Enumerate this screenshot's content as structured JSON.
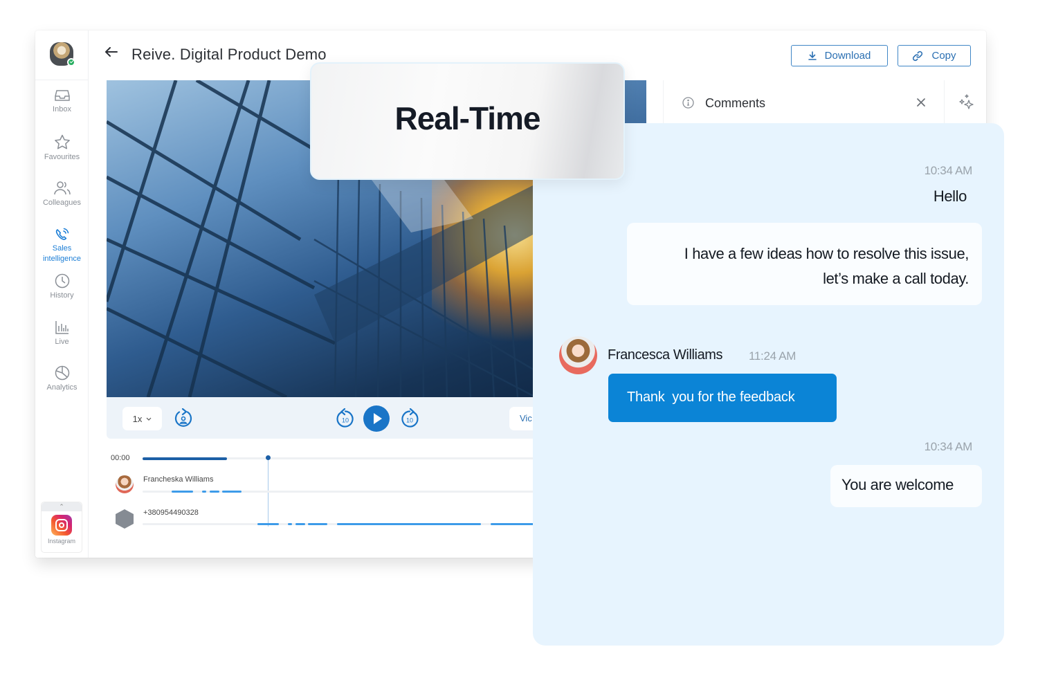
{
  "app": {
    "title": "Reive. Digital Product Demo",
    "actions": {
      "download_label": "Download",
      "copy_label": "Copy"
    }
  },
  "sidebar": {
    "items": [
      {
        "label": "Inbox",
        "icon": "inbox-icon",
        "active": false
      },
      {
        "label": "Favourites",
        "icon": "star-icon",
        "active": false
      },
      {
        "label": "Colleagues",
        "icon": "users-icon",
        "active": false
      },
      {
        "label_line1": "Sales",
        "label_line2": "intelligence",
        "icon": "phone-ringing-icon",
        "active": true
      },
      {
        "label": "History",
        "icon": "clock-icon",
        "active": false
      },
      {
        "label": "Live",
        "icon": "bar-chart-icon",
        "active": false
      },
      {
        "label": "Analytics",
        "icon": "pie-chart-icon",
        "active": false
      }
    ],
    "integration": {
      "label": "Instagram",
      "icon": "instagram-icon"
    }
  },
  "player": {
    "speed": "1x",
    "video_chip_label": "Vic",
    "skip_seconds": "10",
    "time": "00:00",
    "progress_fraction": 0.21
  },
  "timeline": {
    "speakers": [
      {
        "name": "Francheska Williams",
        "type": "person"
      },
      {
        "name": "+380954490328",
        "type": "phone"
      }
    ]
  },
  "comments": {
    "title": "Comments"
  },
  "overlay": {
    "label": "Real-Time"
  },
  "chat": {
    "messages": [
      {
        "time": "10:34 AM",
        "text": "Hello"
      },
      {
        "line1": "I have a few ideas how to resolve this issue,",
        "line2": "let’s make a call today."
      },
      {
        "author": "Francesca Williams",
        "time": "11:24 AM",
        "text": "Thank  you for the feedback"
      },
      {
        "time": "10:34 AM",
        "text": "You are welcome"
      }
    ]
  },
  "colors": {
    "accent": "#1a75c7",
    "chat_bg": "#e7f4fe",
    "bubble_blue": "#0b84d6"
  }
}
